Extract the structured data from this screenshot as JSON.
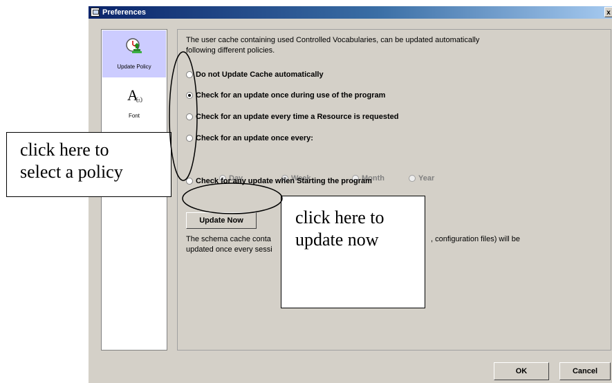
{
  "window": {
    "title": "Preferences",
    "close_glyph": "x"
  },
  "sidebar": {
    "items": [
      {
        "label": "Update Policy",
        "icon": "update-policy-icon",
        "selected": true
      },
      {
        "label": "Font",
        "icon": "font-icon",
        "glyph": "A",
        "glyph_sub": "ω",
        "selected": false
      }
    ]
  },
  "content": {
    "intro_line1": "The user cache containing used Controlled Vocabularies, can be updated automatically",
    "intro_line2": "following different policies.",
    "options": [
      {
        "label": "Do not Update Cache automatically",
        "checked": false
      },
      {
        "label": "Check for an update once during use of the program",
        "checked": true
      },
      {
        "label": "Check for an update every time a Resource is requested",
        "checked": false
      },
      {
        "label": "Check for an update once every:",
        "checked": false
      },
      {
        "label": "Check for any update when Starting the program",
        "checked": false
      }
    ],
    "periods": [
      {
        "label": "Day",
        "checked": false
      },
      {
        "label": "Week",
        "checked": true
      },
      {
        "label": "Month",
        "checked": false
      },
      {
        "label": "Year",
        "checked": false
      }
    ],
    "update_now_label": "Update Now",
    "schema_line1_a": "The schema cache conta",
    "schema_line1_b": ", configuration files) will be",
    "schema_line2": "updated once every sessi"
  },
  "footer": {
    "ok_label": "OK",
    "cancel_label": "Cancel"
  },
  "annotations": {
    "policy_line1": "click here to",
    "policy_line2": "select a policy",
    "update_line1": "click here to",
    "update_line2": "update now"
  }
}
